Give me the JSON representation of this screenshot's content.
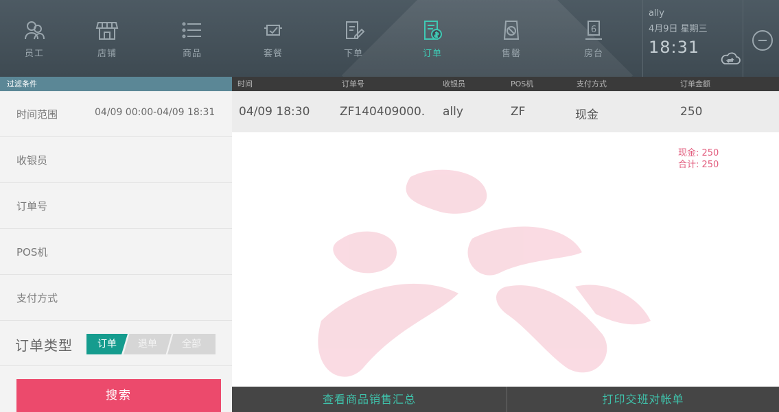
{
  "nav": {
    "items": [
      {
        "label": "员工",
        "icon": "staff-icon"
      },
      {
        "label": "店铺",
        "icon": "store-icon"
      },
      {
        "label": "商品",
        "icon": "list-icon"
      },
      {
        "label": "套餐",
        "icon": "combo-icon"
      },
      {
        "label": "下单",
        "icon": "place-order-icon"
      },
      {
        "label": "订单",
        "icon": "order-icon"
      },
      {
        "label": "售罄",
        "icon": "sold-out-icon"
      },
      {
        "label": "房台",
        "icon": "table-icon"
      }
    ],
    "active_index": 5,
    "table_number": "6"
  },
  "user": {
    "name": "ally",
    "date": "4月9日 星期三",
    "time": "18:31"
  },
  "filter": {
    "header": "过滤条件",
    "rows": [
      {
        "label": "时间范围",
        "value": "04/09 00:00-04/09 18:31"
      },
      {
        "label": "收银员",
        "value": ""
      },
      {
        "label": "订单号",
        "value": ""
      },
      {
        "label": "POS机",
        "value": ""
      },
      {
        "label": "支付方式",
        "value": ""
      }
    ],
    "type_label": "订单类型",
    "type_options": [
      "订单",
      "退单",
      "全部"
    ],
    "type_selected": "订单",
    "search_label": "搜索"
  },
  "table": {
    "columns": [
      "时间",
      "订单号",
      "收银员",
      "POS机",
      "支付方式",
      "订单金额"
    ],
    "rows": [
      {
        "time": "04/09 18:30",
        "order_no": "ZF140409000.",
        "cashier": "ally",
        "pos": "ZF",
        "payment": "现金",
        "amount": "250"
      }
    ]
  },
  "summary": {
    "cash": "现金: 250",
    "total": "合计: 250"
  },
  "bottom": {
    "view_sales": "查看商品销售汇总",
    "print_shift": "打印交班对帐单"
  },
  "colors": {
    "accent": "#3fc9b4",
    "brand_pink": "#ec4a6c",
    "segment_active": "#159c8e",
    "topbar": "#46525a"
  }
}
